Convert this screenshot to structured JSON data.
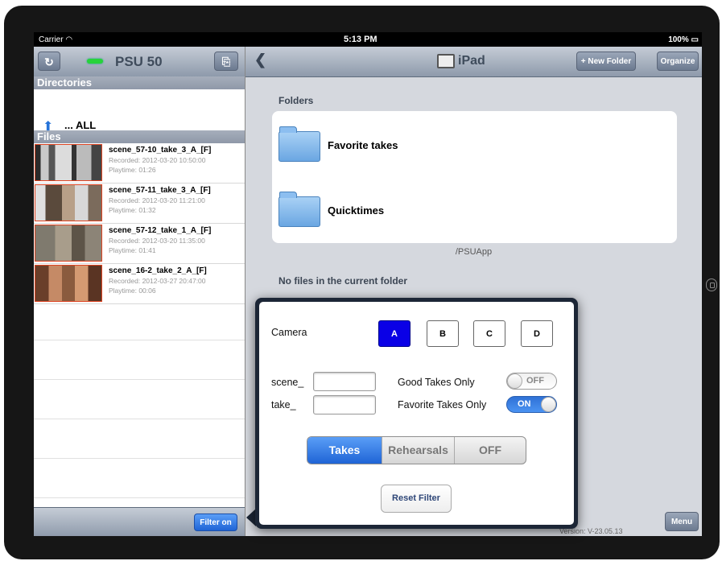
{
  "status_bar": {
    "carrier": "Carrier",
    "time": "5:13 PM",
    "battery": "100%"
  },
  "left_panel": {
    "refresh_icon": "↻",
    "title": "PSU 50",
    "export_icon": "⎘",
    "directories_header": "Directories",
    "dir_item": "... ALL",
    "files_header": "Files",
    "files": [
      {
        "name": "scene_57-10_take_3_A_[F]",
        "recorded": "Recorded: 2012-03-20 10:50:00",
        "playtime": "Playtime: 01:26"
      },
      {
        "name": "scene_57-11_take_3_A_[F]",
        "recorded": "Recorded: 2012-03-20 11:21:00",
        "playtime": "Playtime: 01:32"
      },
      {
        "name": "scene_57-12_take_1_A_[F]",
        "recorded": "Recorded: 2012-03-20 11:35:00",
        "playtime": "Playtime: 01:41"
      },
      {
        "name": "scene_16-2_take_2_A_[F]",
        "recorded": "Recorded: 2012-03-27 20:47:00",
        "playtime": "Playtime: 00:06"
      }
    ],
    "filter_button": "Filter on"
  },
  "right_panel": {
    "back_icon": "❮",
    "title": "iPad",
    "new_folder_button": "+ New Folder",
    "organize_button": "Organize",
    "folders_label": "Folders",
    "folders": [
      "Favorite takes",
      "Quicktimes"
    ],
    "path": "/PSUApp",
    "no_files": "No files in the current folder",
    "version": "Version: V-23.05.13",
    "menu_button": "Menu"
  },
  "filter_popover": {
    "camera_label": "Camera",
    "cameras": [
      "A",
      "B",
      "C",
      "D"
    ],
    "selected_camera": "A",
    "scene_label": "scene_",
    "scene_value": "",
    "take_label": "take_",
    "take_value": "",
    "good_takes_label": "Good Takes Only",
    "good_takes_state": "OFF",
    "favorite_takes_label": "Favorite Takes Only",
    "favorite_takes_state": "ON",
    "segments": [
      "Takes",
      "Rehearsals",
      "OFF"
    ],
    "selected_segment": "Takes",
    "reset_button": "Reset Filter"
  },
  "colors": {
    "selected_camera": "#0a00e6",
    "accent_blue": "#1f64d6",
    "led_green": "#27d33a",
    "thumb_border": "#dd4422"
  }
}
